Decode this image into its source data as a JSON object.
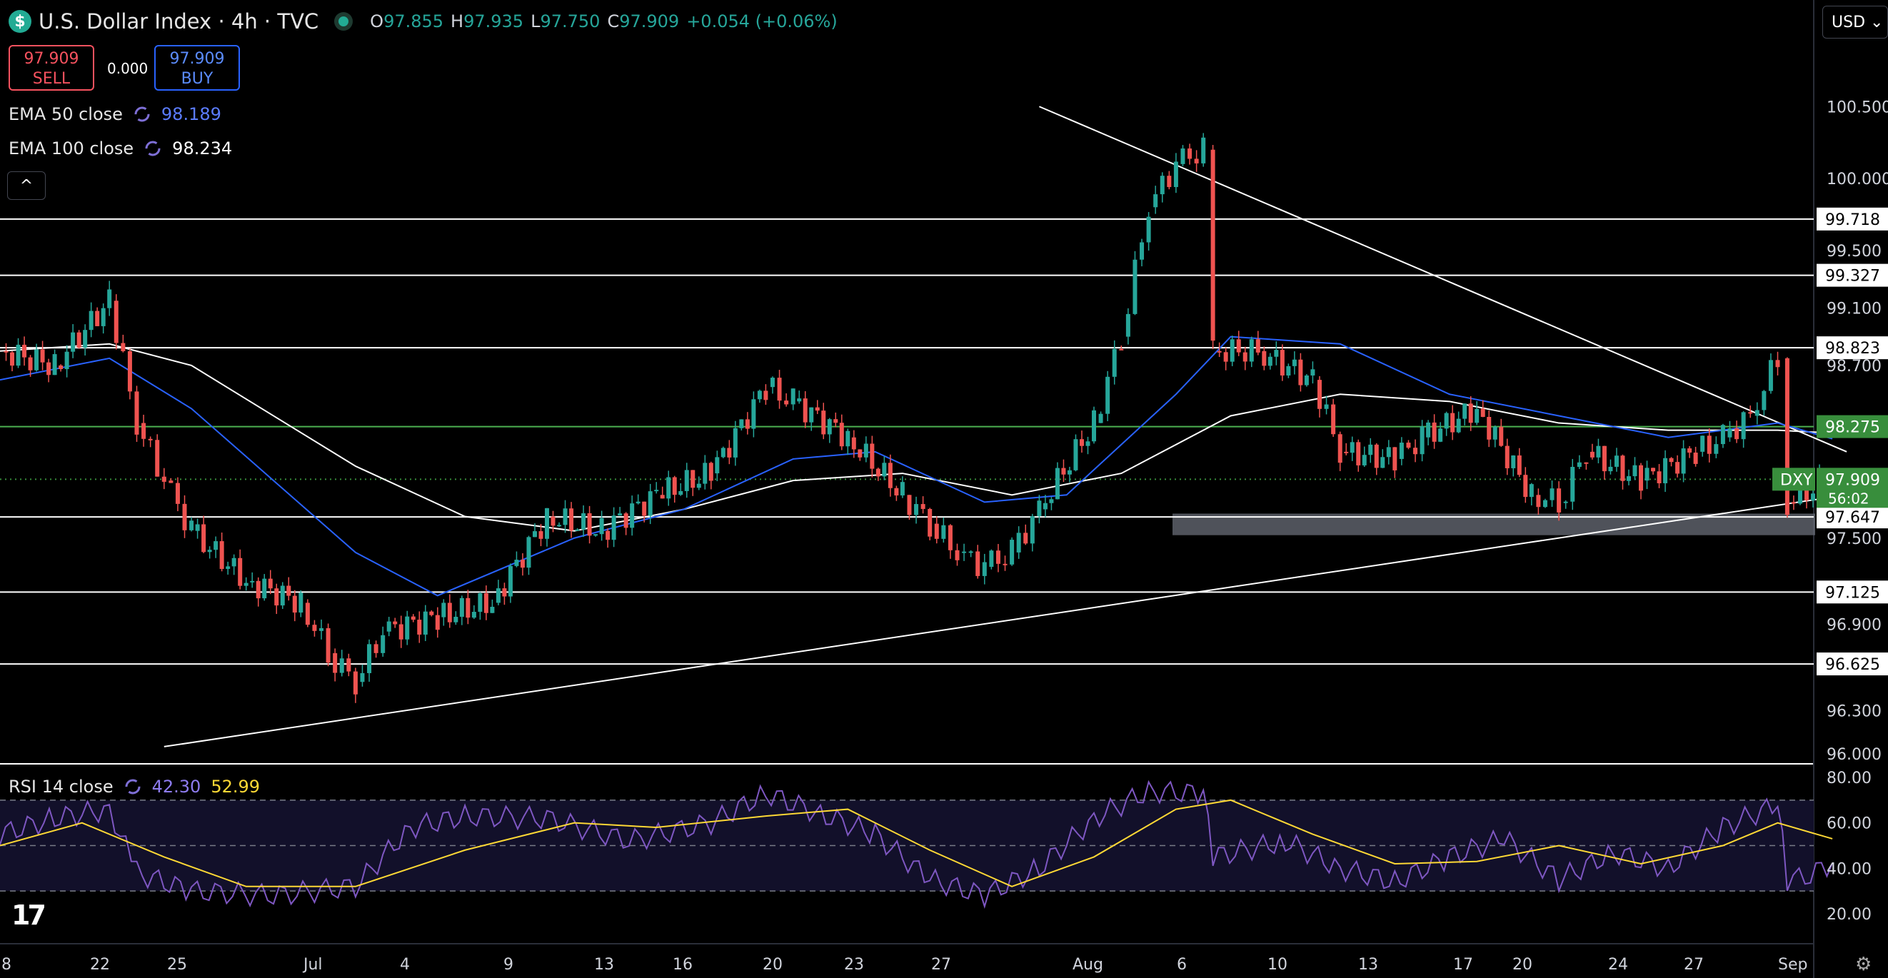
{
  "header": {
    "currency_symbol": "$",
    "title": "U.S. Dollar Index · 4h · TVC",
    "ohlc": [
      {
        "k": "O",
        "v": "97.855"
      },
      {
        "k": "H",
        "v": "97.935"
      },
      {
        "k": "L",
        "v": "97.750"
      },
      {
        "k": "C",
        "v": "97.909"
      },
      {
        "k": "",
        "v": "+0.054 (+0.06%)"
      }
    ]
  },
  "trade": {
    "sell_price": "97.909",
    "sell_label": "SELL",
    "spread": "0.000",
    "buy_price": "97.909",
    "buy_label": "BUY"
  },
  "indicators": {
    "ema50_label": "EMA 50 close",
    "ema50_value": "98.189",
    "ema100_label": "EMA 100 close",
    "ema100_value": "98.234",
    "rsi_label": "RSI 14 close",
    "rsi_value": "42.30",
    "rsi_ma_value": "52.99"
  },
  "controls": {
    "currency": "USD",
    "collapse": "^"
  },
  "colors": {
    "up": "#26a69a",
    "down": "#ef5350",
    "ema50": "#2962ff",
    "ema100": "#ffffff",
    "rsi": "#7e57c2",
    "rsi_ma": "#fdd835",
    "green_level": "#4caf50",
    "badge_green": "#388e3c"
  },
  "chart_data": {
    "type": "line",
    "title": "U.S. Dollar Index · 4h · TVC",
    "symbol": "DXY",
    "last_price": "97.909",
    "countdown": "56:02",
    "ylim": [
      96.0,
      100.8
    ],
    "price_ticks": [
      "100.500",
      "100.000",
      "99.500",
      "99.100",
      "98.700",
      "97.500",
      "96.900",
      "96.300",
      "96.000"
    ],
    "hidden_ticks": [
      "97.300"
    ],
    "x_ticks": [
      "18",
      "22",
      "25",
      "Jul",
      "4",
      "9",
      "13",
      "16",
      "20",
      "23",
      "27",
      "Aug",
      "6",
      "10",
      "13",
      "17",
      "20",
      "24",
      "27",
      "Sep"
    ],
    "horizontal_levels": [
      {
        "value": "99.718",
        "color": "#ffffff"
      },
      {
        "value": "99.327",
        "color": "#ffffff"
      },
      {
        "value": "98.823",
        "color": "#ffffff"
      },
      {
        "value": "98.275",
        "color": "#4caf50"
      },
      {
        "value": "97.647",
        "color": "#ffffff"
      },
      {
        "value": "97.125",
        "color": "#ffffff"
      },
      {
        "value": "96.625",
        "color": "#ffffff"
      }
    ],
    "trendlines": [
      {
        "name": "descending resistance",
        "from": [
          "Jul 26",
          100.5
        ],
        "to": [
          "Aug 24",
          98.1
        ]
      },
      {
        "name": "ascending support",
        "from": [
          "Jun 24",
          96.05
        ],
        "to": [
          "Aug 24",
          97.8
        ]
      }
    ],
    "support_zone": [
      97.55,
      97.67
    ],
    "close_path": [
      [
        "Jun 18",
        98.8
      ],
      [
        "Jun 20",
        98.7
      ],
      [
        "Jun 22",
        99.15
      ],
      [
        "Jun 23",
        98.3
      ],
      [
        "Jun 24",
        97.9
      ],
      [
        "Jun 25",
        97.55
      ],
      [
        "Jun 27",
        97.2
      ],
      [
        "Jun 29",
        97.05
      ],
      [
        "Jun 30",
        96.7
      ],
      [
        "Jul 1",
        96.5
      ],
      [
        "Jul 2",
        96.85
      ],
      [
        "Jul 4",
        96.95
      ],
      [
        "Jul 6",
        97.05
      ],
      [
        "Jul 8",
        97.65
      ],
      [
        "Jul 10",
        97.55
      ],
      [
        "Jul 12",
        97.8
      ],
      [
        "Jul 14",
        97.95
      ],
      [
        "Jul 16",
        98.55
      ],
      [
        "Jul 17",
        98.45
      ],
      [
        "Jul 19",
        98.2
      ],
      [
        "Jul 21",
        97.8
      ],
      [
        "Jul 22",
        97.6
      ],
      [
        "Jul 23",
        97.4
      ],
      [
        "Jul 24",
        97.3
      ],
      [
        "Jul 25",
        97.4
      ],
      [
        "Jul 26",
        97.7
      ],
      [
        "Jul 28",
        98.3
      ],
      [
        "Jul 29",
        98.9
      ],
      [
        "Jul 30",
        99.8
      ],
      [
        "Jul 31",
        100.1
      ],
      [
        "Aug 1",
        100.2
      ],
      [
        "Aug 1b",
        98.8
      ],
      [
        "Aug 3",
        98.8
      ],
      [
        "Aug 5",
        98.6
      ],
      [
        "Aug 6",
        98.1
      ],
      [
        "Aug 8",
        98.05
      ],
      [
        "Aug 9",
        98.2
      ],
      [
        "Aug 11",
        98.4
      ],
      [
        "Aug 13",
        97.8
      ],
      [
        "Aug 14",
        97.75
      ],
      [
        "Aug 15",
        98.1
      ],
      [
        "Aug 17",
        97.9
      ],
      [
        "Aug 19",
        98.1
      ],
      [
        "Aug 20",
        98.2
      ],
      [
        "Aug 21",
        98.35
      ],
      [
        "Aug 22",
        98.75
      ],
      [
        "Aug 22b",
        97.75
      ],
      [
        "Aug 24",
        97.91
      ]
    ],
    "ema50_path": [
      [
        "Jun 18",
        98.6
      ],
      [
        "Jun 22",
        98.75
      ],
      [
        "Jun 25",
        98.4
      ],
      [
        "Jul 1",
        97.4
      ],
      [
        "Jul 4",
        97.1
      ],
      [
        "Jul 9",
        97.5
      ],
      [
        "Jul 13",
        97.7
      ],
      [
        "Jul 17",
        98.05
      ],
      [
        "Jul 20",
        98.1
      ],
      [
        "Jul 24",
        97.75
      ],
      [
        "Jul 27",
        97.8
      ],
      [
        "Jul 31",
        98.5
      ],
      [
        "Aug 2",
        98.9
      ],
      [
        "Aug 6",
        98.85
      ],
      [
        "Aug 10",
        98.5
      ],
      [
        "Aug 14",
        98.35
      ],
      [
        "Aug 18",
        98.2
      ],
      [
        "Aug 22",
        98.3
      ],
      [
        "Aug 24",
        98.19
      ]
    ],
    "ema100_path": [
      [
        "Jun 18",
        98.8
      ],
      [
        "Jun 22",
        98.85
      ],
      [
        "Jun 25",
        98.7
      ],
      [
        "Jul 1",
        98.0
      ],
      [
        "Jul 5",
        97.65
      ],
      [
        "Jul 9",
        97.55
      ],
      [
        "Jul 13",
        97.7
      ],
      [
        "Jul 17",
        97.9
      ],
      [
        "Jul 21",
        97.95
      ],
      [
        "Jul 25",
        97.8
      ],
      [
        "Jul 29",
        97.95
      ],
      [
        "Aug 2",
        98.35
      ],
      [
        "Aug 6",
        98.5
      ],
      [
        "Aug 10",
        98.45
      ],
      [
        "Aug 14",
        98.3
      ],
      [
        "Aug 18",
        98.25
      ],
      [
        "Aug 22",
        98.25
      ],
      [
        "Aug 24",
        98.23
      ]
    ],
    "rsi": {
      "ylim": [
        20,
        80
      ],
      "ticks": [
        "80.00",
        "60.00",
        "40.00",
        "20.00"
      ],
      "bands": [
        70,
        50,
        30
      ],
      "rsi_path": [
        [
          "Jun 18",
          55
        ],
        [
          "Jun 20",
          62
        ],
        [
          "Jun 22",
          66
        ],
        [
          "Jun 23",
          38
        ],
        [
          "Jun 25",
          30
        ],
        [
          "Jun 28",
          28
        ],
        [
          "Jul 1",
          32
        ],
        [
          "Jul 3",
          58
        ],
        [
          "Jul 5",
          63
        ],
        [
          "Jul 8",
          62
        ],
        [
          "Jul 11",
          52
        ],
        [
          "Jul 14",
          60
        ],
        [
          "Jul 16",
          73
        ],
        [
          "Jul 18",
          64
        ],
        [
          "Jul 20",
          55
        ],
        [
          "Jul 22",
          35
        ],
        [
          "Jul 24",
          28
        ],
        [
          "Jul 26",
          40
        ],
        [
          "Jul 28",
          62
        ],
        [
          "Jul 30",
          74
        ],
        [
          "Aug 1",
          73
        ],
        [
          "Aug 1b",
          45
        ],
        [
          "Aug 4",
          52
        ],
        [
          "Aug 6",
          40
        ],
        [
          "Aug 8",
          34
        ],
        [
          "Aug 10",
          45
        ],
        [
          "Aug 12",
          53
        ],
        [
          "Aug 14",
          35
        ],
        [
          "Aug 16",
          47
        ],
        [
          "Aug 18",
          40
        ],
        [
          "Aug 20",
          58
        ],
        [
          "Aug 22",
          68
        ],
        [
          "Aug 22b",
          35
        ],
        [
          "Aug 23",
          36
        ],
        [
          "Aug 24",
          42.3
        ]
      ],
      "ma_path": [
        [
          "Jun 18",
          50
        ],
        [
          "Jun 21",
          60
        ],
        [
          "Jun 24",
          45
        ],
        [
          "Jun 27",
          32
        ],
        [
          "Jul 1",
          32
        ],
        [
          "Jul 5",
          48
        ],
        [
          "Jul 9",
          60
        ],
        [
          "Jul 12",
          58
        ],
        [
          "Jul 16",
          63
        ],
        [
          "Jul 19",
          66
        ],
        [
          "Jul 22",
          48
        ],
        [
          "Jul 25",
          32
        ],
        [
          "Jul 28",
          45
        ],
        [
          "Jul 31",
          66
        ],
        [
          "Aug 2",
          70
        ],
        [
          "Aug 5",
          55
        ],
        [
          "Aug 8",
          42
        ],
        [
          "Aug 11",
          43
        ],
        [
          "Aug 14",
          50
        ],
        [
          "Aug 17",
          42
        ],
        [
          "Aug 20",
          50
        ],
        [
          "Aug 22",
          60
        ],
        [
          "Aug 24",
          53
        ]
      ]
    }
  }
}
